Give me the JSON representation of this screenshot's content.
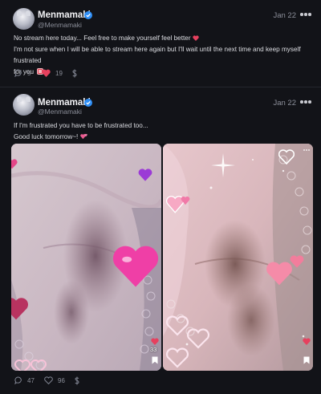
{
  "colors": {
    "background": "#121318",
    "accent_heart": "#e6405e",
    "verified": "#2f8ef5",
    "muted": "#8c8f9a"
  },
  "post1": {
    "author": {
      "name": "Menmamaki",
      "handle": "@Menmamaki",
      "verified_icon": "verified-badge-icon"
    },
    "date": "Jan 22",
    "lines": [
      "No stream here today... Feel free to make yourself feel better",
      "I'm not sure when I will be able to stream here again but I'll wait until the next time and keep myself frustrated",
      "for you"
    ],
    "emoji": [
      "heart-emoji",
      "anger-emoji"
    ],
    "stats": {
      "comments": "5",
      "likes": "19"
    }
  },
  "post2": {
    "author": {
      "name": "Menmamaki",
      "handle": "@Menmamaki",
      "verified_icon": "verified-badge-icon"
    },
    "date": "Jan 22",
    "lines": [
      "If I'm frustrated you have to be frustrated too...",
      "Good luck tomorrow~!"
    ],
    "emoji": [
      "pink-hearts-emoji"
    ],
    "media": [
      {
        "stickers": [
          "pink-heart-sticker",
          "purple-heart-sticker",
          "magenta-heart-sticker"
        ]
      },
      {
        "stickers": [
          "heart-outline-sticker",
          "sparkle-sticker",
          "pink-heart-sticker"
        ],
        "like_count": "33"
      }
    ],
    "stats": {
      "comments": "47",
      "likes": "96"
    }
  }
}
